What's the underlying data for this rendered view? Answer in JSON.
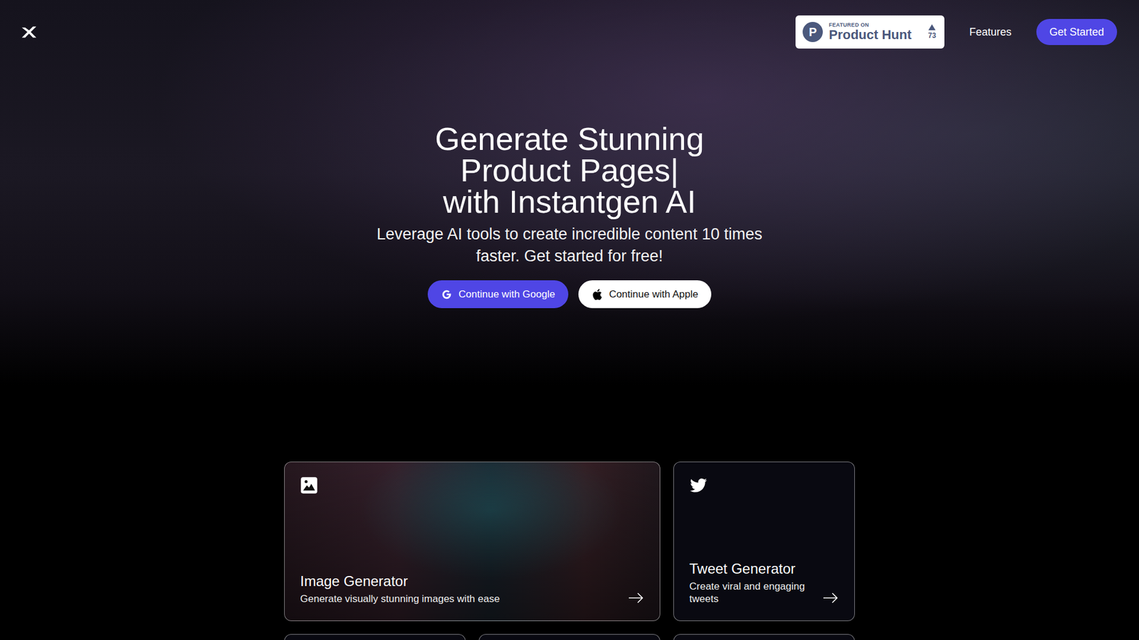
{
  "nav": {
    "badge": {
      "caption": "FEATURED ON",
      "name": "Product Hunt",
      "logo_letter": "P",
      "votes": "73"
    },
    "links": [
      "Features"
    ],
    "cta": "Get Started"
  },
  "hero": {
    "title_lines": [
      "Generate Stunning",
      "Product Pages|",
      "with Instantgen AI"
    ],
    "subtitle": "Leverage AI tools to create incredible content 10 times faster. Get started for free!",
    "buttons": [
      {
        "label": "Continue with Google",
        "kind": "google"
      },
      {
        "label": "Continue with Apple",
        "kind": "apple"
      }
    ]
  },
  "cards": [
    {
      "kind": "image",
      "title": "Image Generator",
      "description": "Generate visually stunning images with ease"
    },
    {
      "kind": "plain",
      "title": "Tweet Generator",
      "description": "Create viral and engaging tweets"
    },
    {
      "kind": "stub"
    },
    {
      "kind": "stub"
    },
    {
      "kind": "stub"
    }
  ]
}
